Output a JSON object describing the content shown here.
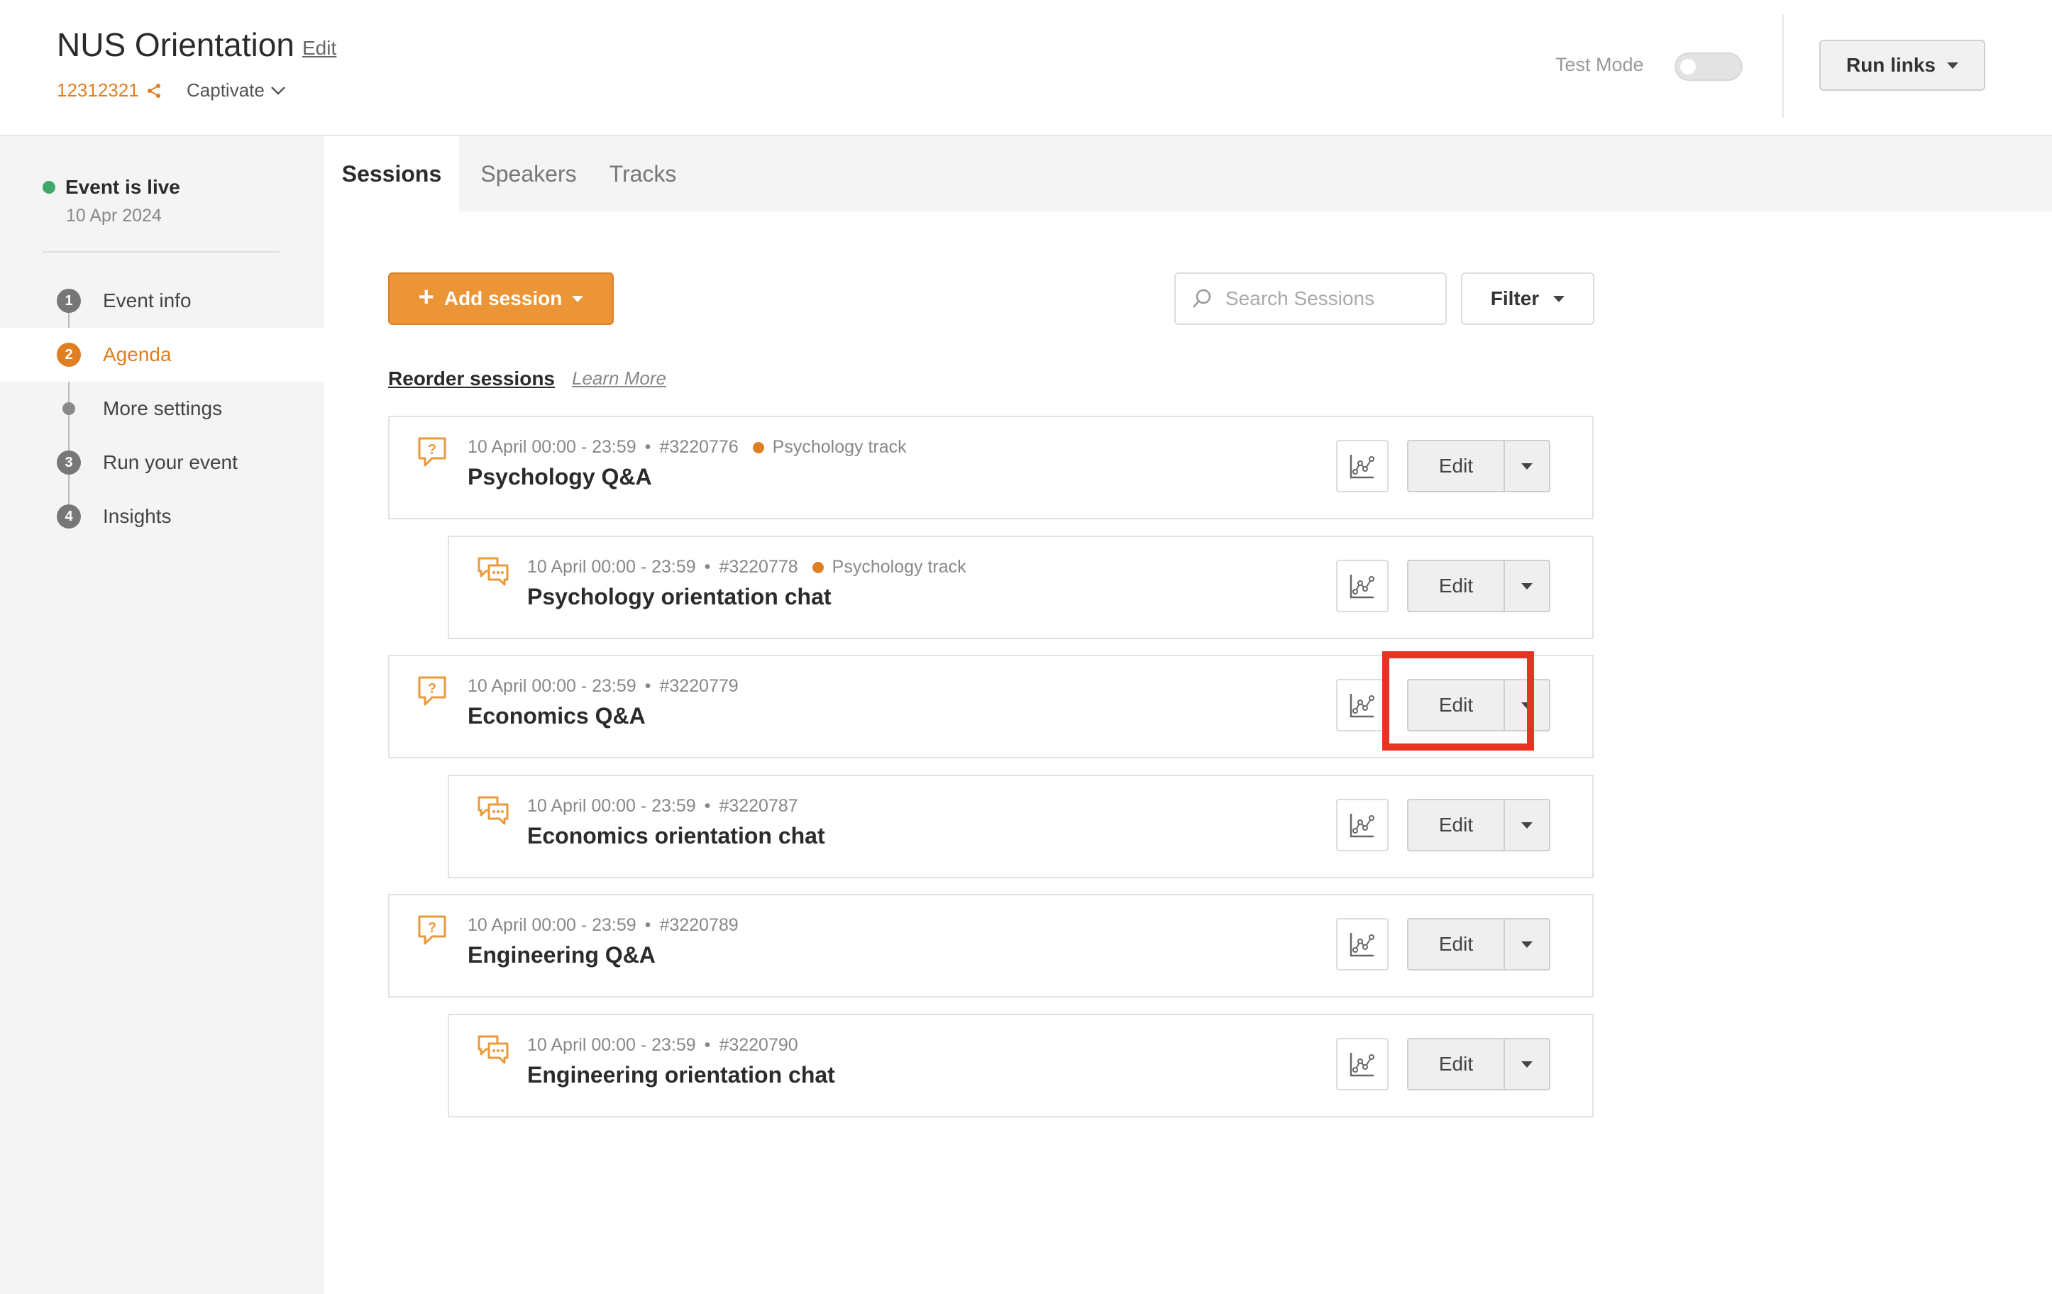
{
  "header": {
    "title": "NUS Orientation",
    "edit_label": "Edit",
    "event_code": "12312321",
    "brand": "Captivate",
    "test_mode_label": "Test Mode",
    "test_mode_on": false,
    "run_links_label": "Run links"
  },
  "sidebar": {
    "status_label": "Event is live",
    "status_date": "10 Apr 2024",
    "steps": [
      {
        "num": "1",
        "label": "Event info"
      },
      {
        "num": "2",
        "label": "Agenda"
      },
      {
        "num": "",
        "label": "More settings"
      },
      {
        "num": "3",
        "label": "Run your event"
      },
      {
        "num": "4",
        "label": "Insights"
      }
    ]
  },
  "tabs": [
    {
      "label": "Sessions"
    },
    {
      "label": "Speakers"
    },
    {
      "label": "Tracks"
    }
  ],
  "toolbar": {
    "add_session_label": "Add session",
    "search_placeholder": "Search Sessions",
    "filter_label": "Filter",
    "reorder_label": "Reorder sessions",
    "learn_more_label": "Learn More"
  },
  "sessions": [
    {
      "type": "qa",
      "time": "10 April 00:00 - 23:59",
      "id": "#3220776",
      "track": "Psychology track",
      "title": "Psychology Q&A",
      "edit_label": "Edit"
    },
    {
      "type": "chat",
      "time": "10 April 00:00 - 23:59",
      "id": "#3220778",
      "track": "Psychology track",
      "title": "Psychology orientation chat",
      "edit_label": "Edit"
    },
    {
      "type": "qa",
      "time": "10 April 00:00 - 23:59",
      "id": "#3220779",
      "track": "",
      "title": "Economics Q&A",
      "edit_label": "Edit"
    },
    {
      "type": "chat",
      "time": "10 April 00:00 - 23:59",
      "id": "#3220787",
      "track": "",
      "title": "Economics orientation chat",
      "edit_label": "Edit"
    },
    {
      "type": "qa",
      "time": "10 April 00:00 - 23:59",
      "id": "#3220789",
      "track": "",
      "title": "Engineering Q&A",
      "edit_label": "Edit"
    },
    {
      "type": "chat",
      "time": "10 April 00:00 - 23:59",
      "id": "#3220790",
      "track": "",
      "title": "Engineering orientation chat",
      "edit_label": "Edit"
    }
  ],
  "colors": {
    "accent": "#e07f22",
    "add_button": "#eb9536",
    "live": "#3fa96b",
    "highlight": "#e63323"
  }
}
